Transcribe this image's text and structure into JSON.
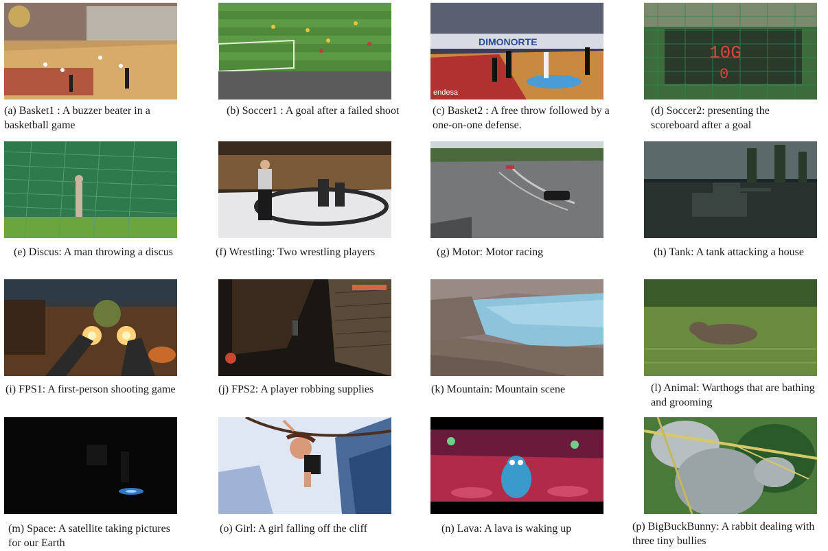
{
  "figure": {
    "panels": [
      {
        "id": "a",
        "caption": "(a) Basket1 : A buzzer beater in a basketball game"
      },
      {
        "id": "b",
        "caption": "(b) Soccer1 : A goal after a failed shoot"
      },
      {
        "id": "c",
        "caption": "(c) Basket2 : A free throw followed by a one-on-one defense."
      },
      {
        "id": "d",
        "caption": "(d) Soccer2: presenting the scoreboard after a goal"
      },
      {
        "id": "e",
        "caption": "(e) Discus: A man throwing a discus"
      },
      {
        "id": "f",
        "caption": "(f) Wrestling: Two wrestling players"
      },
      {
        "id": "g",
        "caption": "(g) Motor: Motor racing"
      },
      {
        "id": "h",
        "caption": "(h) Tank: A tank attacking a house"
      },
      {
        "id": "i",
        "caption": "(i) FPS1: A first-person shooting game"
      },
      {
        "id": "j",
        "caption": "(j) FPS2: A player robbing supplies"
      },
      {
        "id": "k",
        "caption": "(k) Mountain: Mountain scene"
      },
      {
        "id": "l",
        "caption": "(l) Animal:  Warthogs that are bathing and grooming"
      },
      {
        "id": "m",
        "caption": "(m) Space: A satellite taking pictures for our Earth"
      },
      {
        "id": "o",
        "caption": "(o) Girl: A girl falling off the cliff"
      },
      {
        "id": "n",
        "caption": "(n) Lava: A lava is waking up"
      },
      {
        "id": "p",
        "caption": "(p) BigBuckBunny: A rabbit dealing with three tiny bullies"
      }
    ]
  },
  "overlay_text": {
    "basket2_banner": "DIMONORTE",
    "basket2_sponsor": "endesa",
    "scoreboard_top": "10G",
    "scoreboard_bottom": "0"
  }
}
